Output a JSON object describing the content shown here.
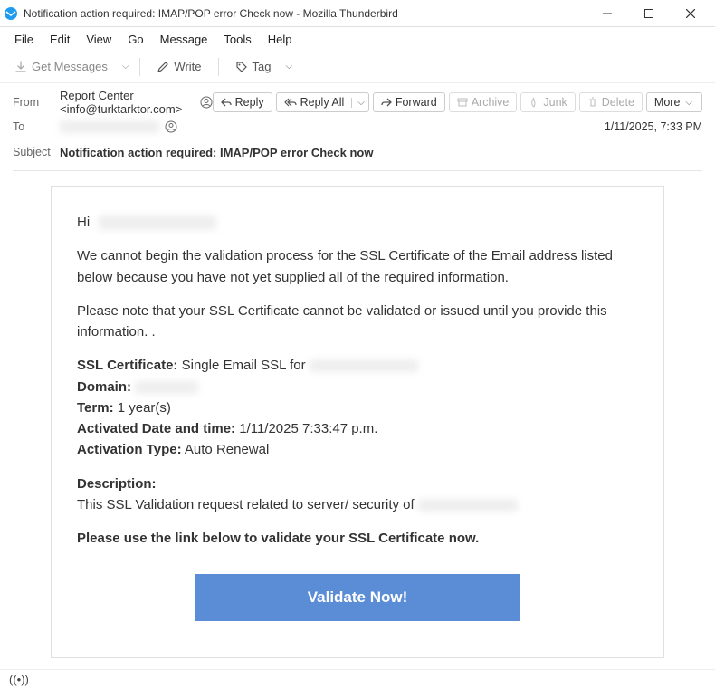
{
  "window": {
    "title": "Notification action required: IMAP/POP error Check now - Mozilla Thunderbird"
  },
  "menubar": {
    "file": "File",
    "edit": "Edit",
    "view": "View",
    "go": "Go",
    "message": "Message",
    "tools": "Tools",
    "help": "Help"
  },
  "toolbar": {
    "get_messages": "Get Messages",
    "write": "Write",
    "tag": "Tag"
  },
  "headers": {
    "from_label": "From",
    "from_value": "Report Center <info@turktarktor.com>",
    "to_label": "To",
    "to_value_redacted": "xxxxxxxxxxxxxx",
    "subject_label": "Subject",
    "subject_value": "Notification action required: IMAP/POP error Check now",
    "date": "1/11/2025, 7:33 PM"
  },
  "actions": {
    "reply": "Reply",
    "reply_all": "Reply All",
    "forward": "Forward",
    "archive": "Archive",
    "junk": "Junk",
    "delete": "Delete",
    "more": "More"
  },
  "body": {
    "greet_prefix": "Hi",
    "greet_name_redacted": "xxxxxxxxxxxxxx",
    "p1": "We cannot begin the validation process for the SSL Certificate of the Email address listed below because you have not yet supplied all of the required information.",
    "p2": "Please note that your SSL Certificate cannot be validated or issued until you provide this information. .",
    "ssl_cert_label": "SSL Certificate:",
    "ssl_cert_value": "Single Email SSL for",
    "ssl_cert_redacted": "xxxxxxxxxxxxxx",
    "domain_label": "Domain:",
    "domain_redacted": "xxxxxxxxx",
    "term_label": "Term:",
    "term_value": "1 year(s)",
    "activated_label": "Activated Date and time:",
    "activated_value": "1/11/2025 7:33:47 p.m.",
    "activation_type_label": "Activation Type:",
    "activation_type_value": "Auto Renewal",
    "desc_label": "Description:",
    "desc_value": "This SSL Validation request related to server/ security of",
    "desc_redacted": "xxxxxxxxxxxxxx",
    "cta_line": "Please use the link below to validate your SSL Certificate now.",
    "button": "Validate Now!"
  }
}
